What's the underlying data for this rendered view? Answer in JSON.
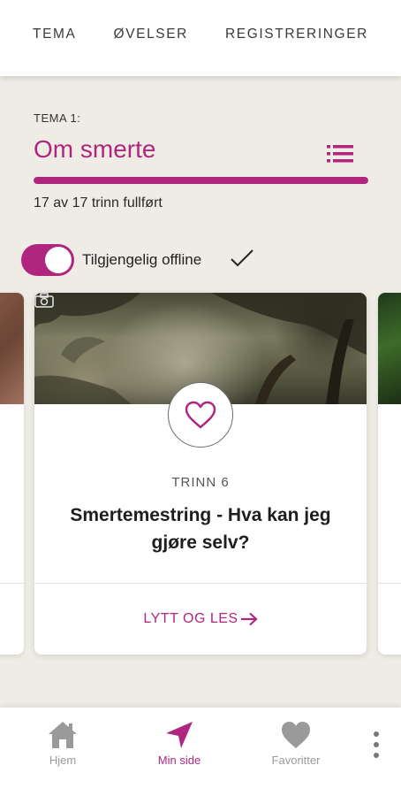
{
  "top_tabs": [
    "TEMA",
    "ØVELSER",
    "REGISTRERINGER"
  ],
  "tema": {
    "label": "TEMA 1:",
    "title": "Om smerte",
    "progress_fraction": 1.0,
    "progress_text": "17 av 17 trinn fullført"
  },
  "offline": {
    "label": "Tilgjengelig offline",
    "enabled": true
  },
  "card": {
    "step_label": "TRINN 6",
    "title": "Smertemestring - Hva kan jeg gjøre selv?",
    "action_label": "LYTT OG LES"
  },
  "bottom_nav": {
    "items": [
      {
        "label": "Hjem",
        "icon": "home-icon"
      },
      {
        "label": "Min side",
        "icon": "navigation-arrow-icon"
      },
      {
        "label": "Favoritter",
        "icon": "heart-icon"
      }
    ],
    "active_index": 1
  },
  "colors": {
    "accent": "#b0267f",
    "background": "#efece6",
    "inactive": "#9a9a9a"
  }
}
